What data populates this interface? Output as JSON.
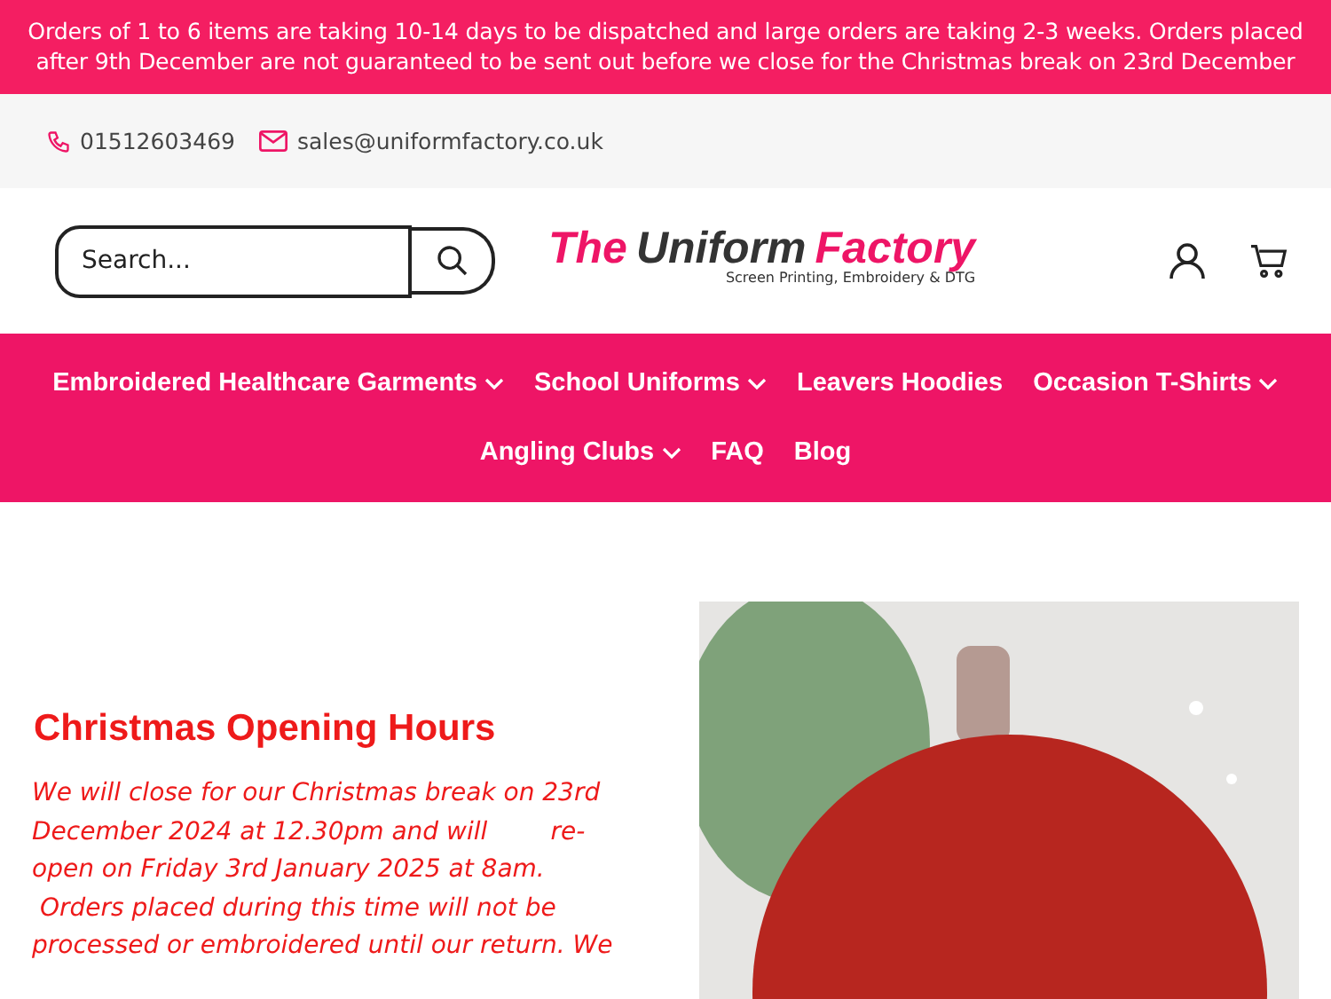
{
  "announcement": "Orders of 1 to 6 items are taking 10-14 days to be dispatched and large orders are taking 2-3 weeks. Orders placed after 9th December are not guaranteed to be sent out before we close for the Christmas break on 23rd December",
  "contact": {
    "phone": "01512603469",
    "email": "sales@uniformfactory.co.uk"
  },
  "search": {
    "placeholder": "Search..."
  },
  "logo": {
    "words": [
      "The",
      "Uniform",
      "Factory"
    ],
    "tagline": "Screen Printing, Embroidery & DTG"
  },
  "nav": [
    {
      "label": "Embroidered Healthcare Garments",
      "dropdown": true
    },
    {
      "label": "School Uniforms",
      "dropdown": true
    },
    {
      "label": "Leavers Hoodies",
      "dropdown": false
    },
    {
      "label": "Occasion T-Shirts",
      "dropdown": true
    },
    {
      "label": "Angling Clubs",
      "dropdown": true
    },
    {
      "label": "FAQ",
      "dropdown": false
    },
    {
      "label": "Blog",
      "dropdown": false
    }
  ],
  "content": {
    "heading": "Christmas Opening Hours",
    "lines": [
      "We will close for our Christmas break on 23rd",
      "December 2024 at 12.30pm and will        re-",
      "open on Friday 3rd January 2025 at 8am.",
      " Orders placed during this time will not be",
      "processed or embroidered until our return. We"
    ]
  }
}
